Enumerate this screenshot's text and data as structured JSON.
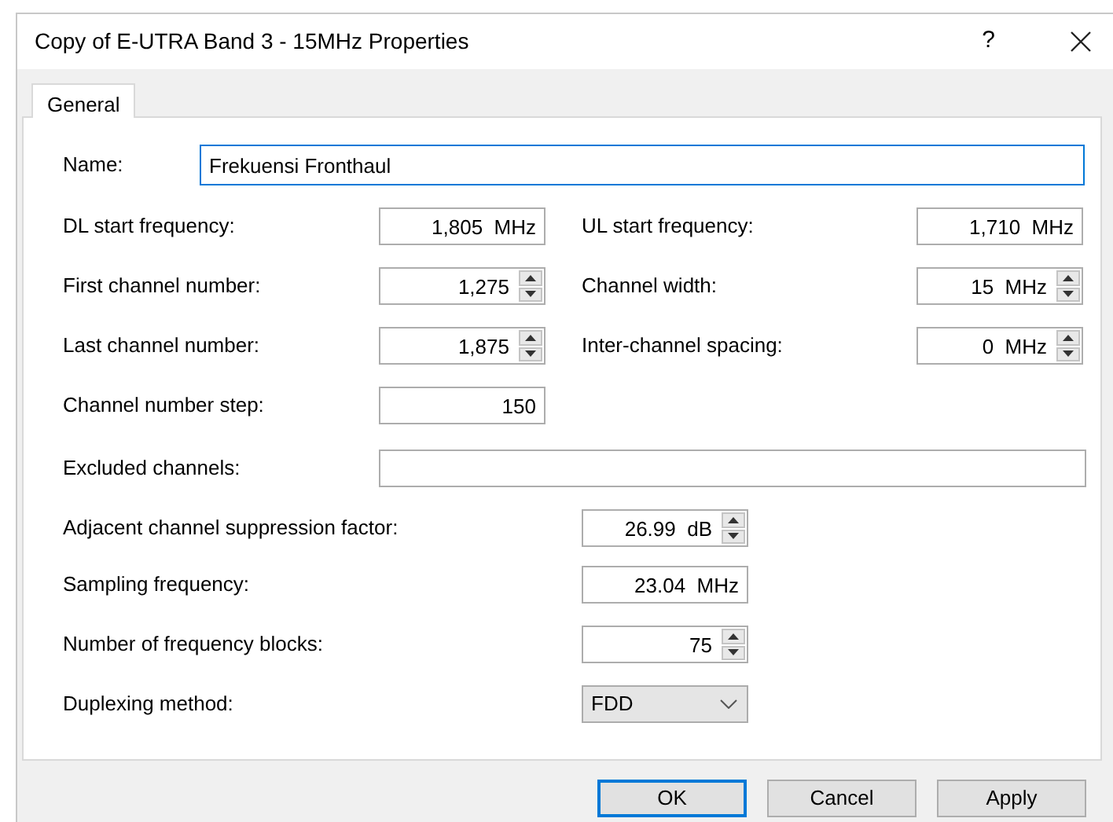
{
  "window": {
    "title": "Copy of E-UTRA Band 3 - 15MHz Properties",
    "help": "?"
  },
  "tabs": [
    {
      "label": "General",
      "selected": true
    }
  ],
  "name_field": {
    "label": "Name:",
    "value": "Frekuensi Fronthaul",
    "focused": true
  },
  "upper_rows": [
    {
      "left": {
        "label": "DL start frequency:",
        "value": "1,805  MHz",
        "kind": "text"
      },
      "right": {
        "label": "UL start frequency:",
        "value": "1,710  MHz",
        "kind": "text"
      }
    },
    {
      "left": {
        "label": "First channel number:",
        "value": "1,275",
        "kind": "spin"
      },
      "right": {
        "label": "Channel width:",
        "value": "15  MHz",
        "kind": "spin"
      }
    },
    {
      "left": {
        "label": "Last channel number:",
        "value": "1,875",
        "kind": "spin"
      },
      "right": {
        "label": "Inter-channel spacing:",
        "value": "0  MHz",
        "kind": "spin"
      }
    },
    {
      "left": {
        "label": "Channel number step:",
        "value": "150",
        "kind": "text"
      }
    }
  ],
  "excluded_channels": {
    "label": "Excluded channels:"
  },
  "lower_rows": [
    {
      "label": "Adjacent channel suppression factor:",
      "value": "26.99  dB",
      "kind": "spin"
    },
    {
      "label": "Sampling frequency:",
      "value": "23.04  MHz",
      "kind": "text"
    },
    {
      "label": "Number of frequency blocks:",
      "value": "75",
      "kind": "spin"
    },
    {
      "label": "Duplexing method:",
      "value": "FDD",
      "kind": "dropdown"
    }
  ],
  "buttons": [
    {
      "label": "OK",
      "default": true
    },
    {
      "label": "Cancel",
      "default": false
    },
    {
      "label": "Apply",
      "default": false
    }
  ]
}
